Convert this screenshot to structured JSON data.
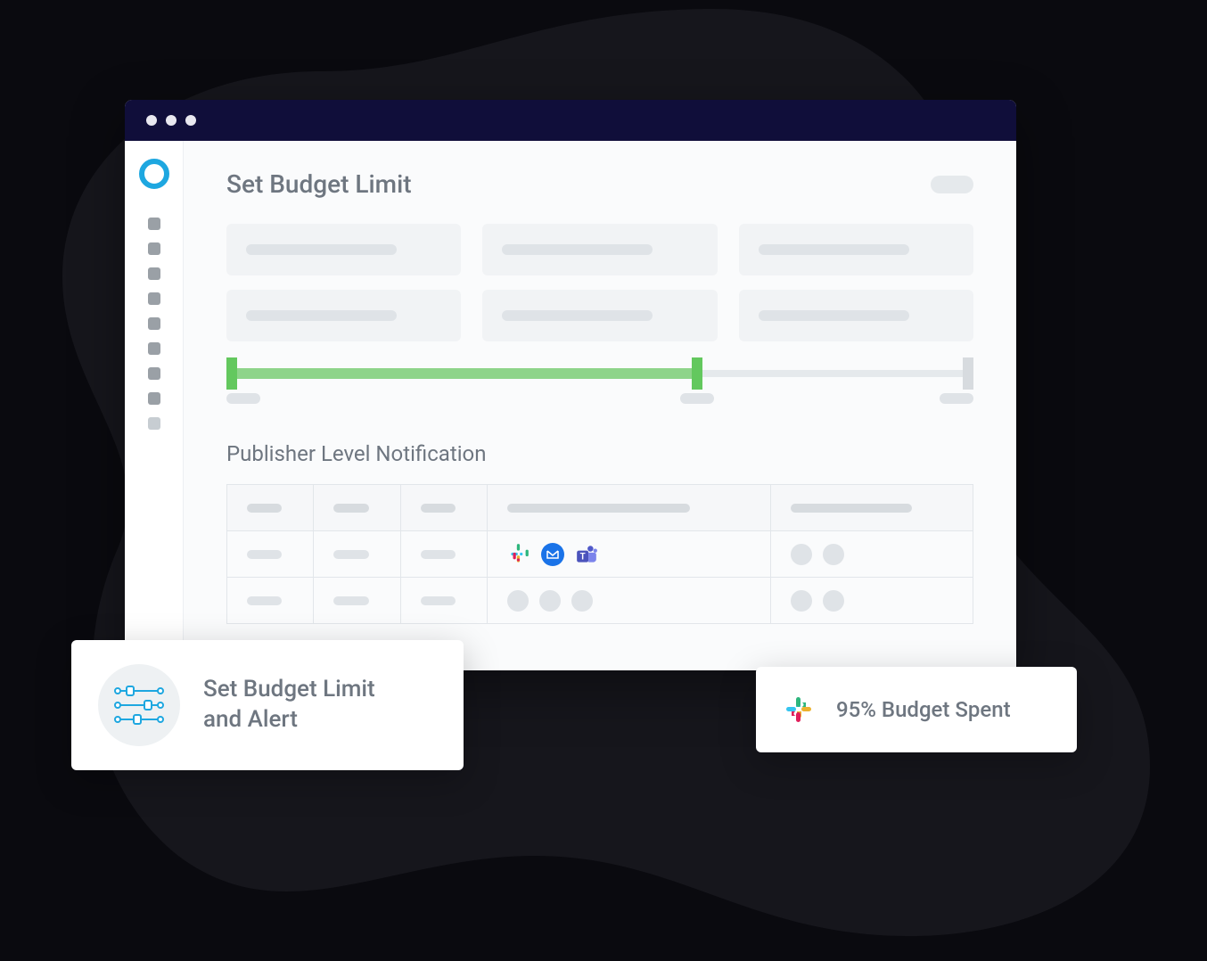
{
  "main": {
    "title": "Set Budget Limit",
    "section_title": "Publisher Level Notification"
  },
  "progress": {
    "percent": 63
  },
  "icons": {
    "slack": "slack-icon",
    "email": "email-icon",
    "teams": "teams-icon",
    "sliders": "sliders-icon"
  },
  "float_cards": {
    "left": {
      "line1": "Set Budget Limit",
      "line2": "and Alert"
    },
    "right": {
      "text": "95% Budget Spent"
    }
  }
}
